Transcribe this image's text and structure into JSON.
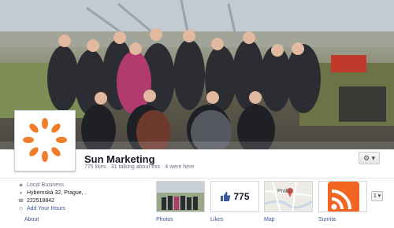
{
  "page": {
    "name": "Sun Marketing",
    "stats": "775 likes · 31 talking about this · 4 were here"
  },
  "about": {
    "category": "Local Business",
    "address": "Hybernská 32, Prague, .",
    "phone": "222518842",
    "hours_link": "Add Your Hours",
    "label": "About"
  },
  "apps": {
    "photos_label": "Photos",
    "likes_label": "Likes",
    "likes_count": "775",
    "map_label": "Map",
    "map_city": "Praha",
    "rss_label": "Sunrita"
  },
  "controls": {
    "gear": "⚙ ▾",
    "app_count": "1 ▾"
  },
  "colors": {
    "link": "#3b5998",
    "logo_orange": "#f07d2a",
    "rss_orange": "#f26522"
  }
}
